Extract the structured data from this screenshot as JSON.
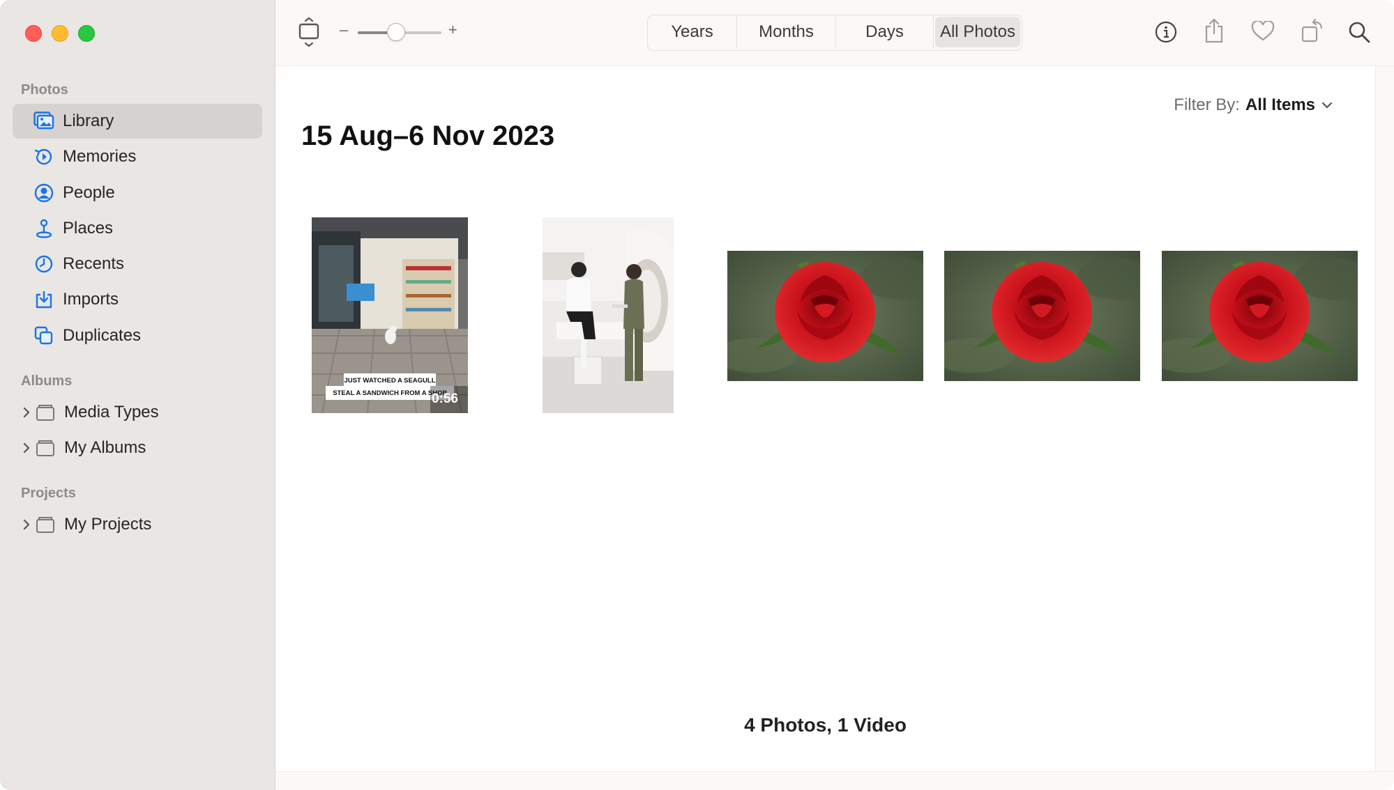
{
  "sidebar": {
    "sections": {
      "photos": "Photos",
      "albums": "Albums",
      "projects": "Projects"
    },
    "items": [
      {
        "label": "Library",
        "icon": "library-icon",
        "selected": true
      },
      {
        "label": "Memories",
        "icon": "memories-icon"
      },
      {
        "label": "People",
        "icon": "people-icon"
      },
      {
        "label": "Places",
        "icon": "places-icon"
      },
      {
        "label": "Recents",
        "icon": "recents-icon"
      },
      {
        "label": "Imports",
        "icon": "imports-icon"
      },
      {
        "label": "Duplicates",
        "icon": "duplicates-icon"
      }
    ],
    "albums": [
      {
        "label": "Media Types",
        "icon": "folder-icon"
      },
      {
        "label": "My Albums",
        "icon": "folder-icon"
      }
    ],
    "projects": [
      {
        "label": "My Projects",
        "icon": "folder-icon"
      }
    ]
  },
  "toolbar": {
    "zoom_minus": "–",
    "zoom_plus": "+",
    "zoom_level": 0.45,
    "view_tabs": [
      {
        "label": "Years"
      },
      {
        "label": "Months"
      },
      {
        "label": "Days"
      },
      {
        "label": "All Photos",
        "active": true
      }
    ],
    "icons": [
      "info-icon",
      "share-icon",
      "heart-icon",
      "rotate-icon",
      "search-icon"
    ]
  },
  "main": {
    "filter_label": "Filter By:",
    "filter_value": "All Items",
    "date_range": "15 Aug–6 Nov 2023",
    "thumbnails": [
      {
        "type": "video",
        "subject": "seagull-shop",
        "caption_line1": "JUST WATCHED A SEAGULL",
        "caption_line2": "STEAL A SANDWICH FROM A SHOP",
        "duration": "0:56"
      },
      {
        "type": "photo",
        "subject": "mri-room"
      },
      {
        "type": "photo",
        "subject": "red-rose"
      },
      {
        "type": "photo",
        "subject": "red-rose"
      },
      {
        "type": "photo",
        "subject": "red-rose"
      }
    ],
    "count_text": "4 Photos, 1 Video"
  },
  "colors": {
    "accent": "#1a73e8",
    "sidebar_bg": "#e9e6e4",
    "toolbar_bg": "#fbf8f6",
    "rose": "#c8111b"
  }
}
